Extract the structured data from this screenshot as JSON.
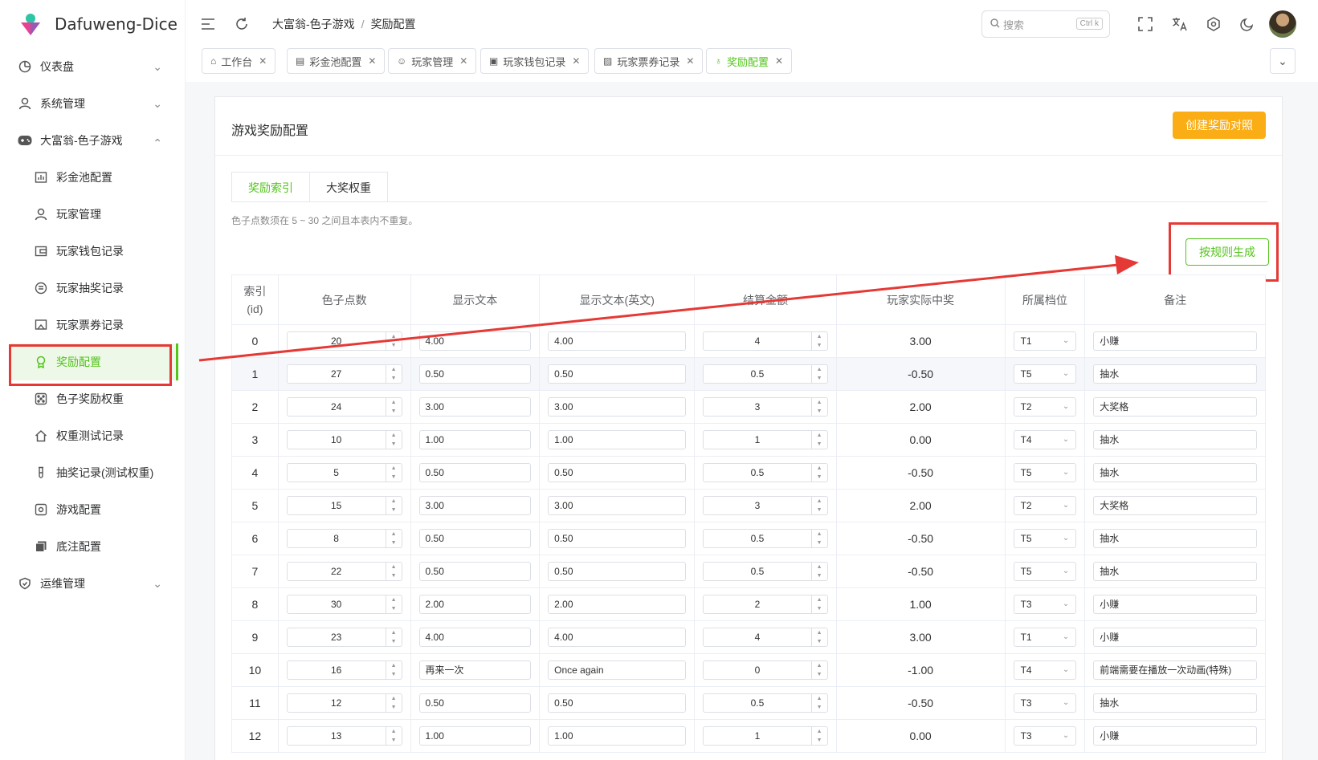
{
  "app": {
    "name": "Dafuweng-Dice"
  },
  "sidebar": {
    "items": [
      {
        "label": "仪表盘",
        "icon": "dashboard-icon",
        "chevron": "⌄"
      },
      {
        "label": "系统管理",
        "icon": "user-icon",
        "chevron": "⌄"
      },
      {
        "label": "大富翁-色子游戏",
        "icon": "gamepad-icon",
        "chevron": "⌃"
      },
      {
        "label": "彩金池配置",
        "icon": "chart-icon"
      },
      {
        "label": "玩家管理",
        "icon": "user-icon"
      },
      {
        "label": "玩家钱包记录",
        "icon": "wallet-icon"
      },
      {
        "label": "玩家抽奖记录",
        "icon": "record-icon"
      },
      {
        "label": "玩家票券记录",
        "icon": "ticket-icon"
      },
      {
        "label": "奖励配置",
        "icon": "award-icon"
      },
      {
        "label": "色子奖励权重",
        "icon": "dice-icon"
      },
      {
        "label": "权重测试记录",
        "icon": "home-icon"
      },
      {
        "label": "抽奖记录(测试权重)",
        "icon": "test-tube-icon"
      },
      {
        "label": "游戏配置",
        "icon": "settings-icon"
      },
      {
        "label": "底注配置",
        "icon": "stack-icon"
      },
      {
        "label": "运维管理",
        "icon": "shield-icon",
        "chevron": "⌄"
      }
    ]
  },
  "header": {
    "breadcrumb": [
      "大富翁-色子游戏",
      "奖励配置"
    ],
    "breadcrumb_sep": "/",
    "search_placeholder": "搜索",
    "search_shortcut": "Ctrl k"
  },
  "tabs": [
    {
      "label": "工作台"
    },
    {
      "label": "彩金池配置"
    },
    {
      "label": "玩家管理"
    },
    {
      "label": "玩家钱包记录"
    },
    {
      "label": "玩家票券记录"
    },
    {
      "label": "奖励配置"
    }
  ],
  "card": {
    "title": "游戏奖励配置",
    "create_button": "创建奖励对照",
    "tabs": [
      "奖励索引",
      "大奖权重"
    ],
    "hint": "色子点数须在 5 ~ 30 之间且本表内不重复。",
    "generate_button": "按规则生成"
  },
  "table": {
    "headers": [
      "索引\n(id)",
      "色子点数",
      "显示文本",
      "显示文本(英文)",
      "结算金额",
      "玩家实际中奖",
      "所属档位",
      "备注"
    ],
    "rows": [
      {
        "id": "0",
        "dice": "20",
        "text": "4.00",
        "text_en": "4.00",
        "amount": "4",
        "actual": "3.00",
        "tier": "T1",
        "note": "小赚"
      },
      {
        "id": "1",
        "dice": "27",
        "text": "0.50",
        "text_en": "0.50",
        "amount": "0.5",
        "actual": "-0.50",
        "tier": "T5",
        "note": "抽水"
      },
      {
        "id": "2",
        "dice": "24",
        "text": "3.00",
        "text_en": "3.00",
        "amount": "3",
        "actual": "2.00",
        "tier": "T2",
        "note": "大奖格"
      },
      {
        "id": "3",
        "dice": "10",
        "text": "1.00",
        "text_en": "1.00",
        "amount": "1",
        "actual": "0.00",
        "tier": "T4",
        "note": "抽水"
      },
      {
        "id": "4",
        "dice": "5",
        "text": "0.50",
        "text_en": "0.50",
        "amount": "0.5",
        "actual": "-0.50",
        "tier": "T5",
        "note": "抽水"
      },
      {
        "id": "5",
        "dice": "15",
        "text": "3.00",
        "text_en": "3.00",
        "amount": "3",
        "actual": "2.00",
        "tier": "T2",
        "note": "大奖格"
      },
      {
        "id": "6",
        "dice": "8",
        "text": "0.50",
        "text_en": "0.50",
        "amount": "0.5",
        "actual": "-0.50",
        "tier": "T5",
        "note": "抽水"
      },
      {
        "id": "7",
        "dice": "22",
        "text": "0.50",
        "text_en": "0.50",
        "amount": "0.5",
        "actual": "-0.50",
        "tier": "T5",
        "note": "抽水"
      },
      {
        "id": "8",
        "dice": "30",
        "text": "2.00",
        "text_en": "2.00",
        "amount": "2",
        "actual": "1.00",
        "tier": "T3",
        "note": "小赚"
      },
      {
        "id": "9",
        "dice": "23",
        "text": "4.00",
        "text_en": "4.00",
        "amount": "4",
        "actual": "3.00",
        "tier": "T1",
        "note": "小赚"
      },
      {
        "id": "10",
        "dice": "16",
        "text": "再来一次",
        "text_en": "Once again",
        "amount": "0",
        "actual": "-1.00",
        "tier": "T4",
        "note": "前端需要在播放一次动画(特殊)"
      },
      {
        "id": "11",
        "dice": "12",
        "text": "0.50",
        "text_en": "0.50",
        "amount": "0.5",
        "actual": "-0.50",
        "tier": "T3",
        "note": "抽水"
      },
      {
        "id": "12",
        "dice": "13",
        "text": "1.00",
        "text_en": "1.00",
        "amount": "1",
        "actual": "0.00",
        "tier": "T3",
        "note": "小赚"
      }
    ]
  },
  "colors": {
    "accent": "#52c41a",
    "warning": "#faad14",
    "annotation": "#e53935"
  }
}
